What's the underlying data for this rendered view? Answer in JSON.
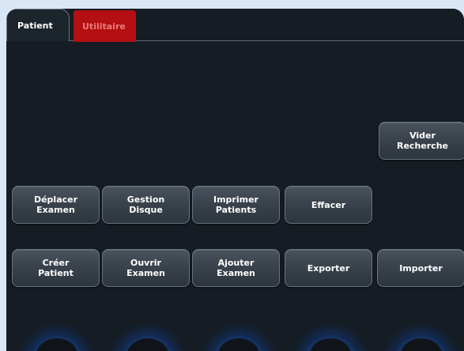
{
  "tabs": [
    {
      "label": "Patient",
      "active": true
    },
    {
      "label": "Utilitaire",
      "active": false,
      "color": "#b40f12"
    }
  ],
  "buttons": {
    "vider_recherche": "Vider\nRecherche",
    "deplacer_examen": "Déplacer\nExamen",
    "gestion_disque": "Gestion\nDisque",
    "imprimer_patients": "Imprimer\nPatients",
    "effacer": "Effacer",
    "creer_patient": "Créer\nPatient",
    "ouvrir_examen": "Ouvrir\nExamen",
    "ajouter_examen": "Ajouter\nExamen",
    "exporter": "Exporter",
    "importer": "Importer"
  },
  "colors": {
    "background": "#151c23",
    "knob_glow": "#1f6fd6"
  }
}
